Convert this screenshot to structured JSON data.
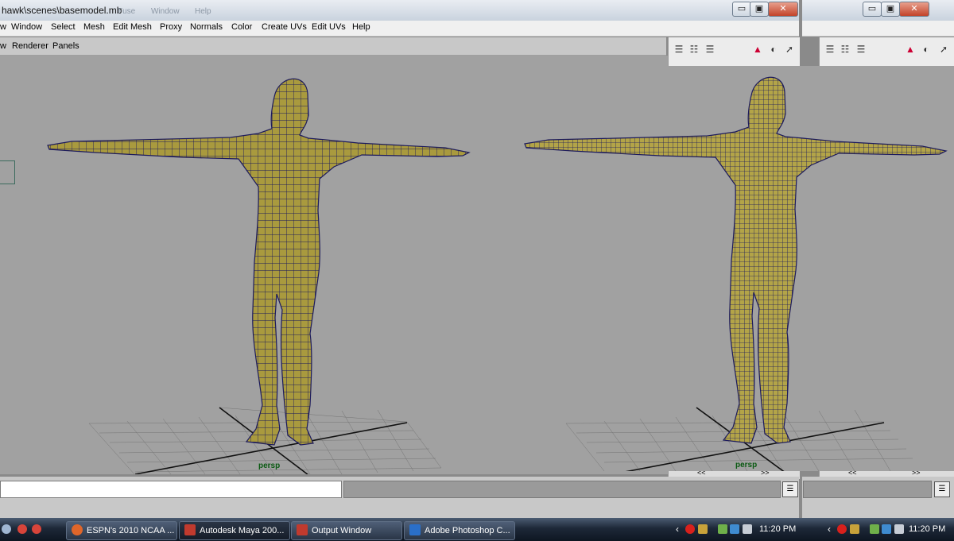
{
  "window": {
    "title": "hawk\\scenes\\basemodel.mb",
    "faded_menu": [
      "Fuse",
      "Window",
      "Help"
    ],
    "minimize": "▭",
    "maximize": "▣",
    "close": "✕"
  },
  "menubar": [
    "w",
    "Window",
    "Select",
    "Mesh",
    "Edit Mesh",
    "Proxy",
    "Normals",
    "Color",
    "Create UVs",
    "Edit UVs",
    "Help"
  ],
  "panel_menu": [
    "w",
    "Renderer",
    "Panels"
  ],
  "viewports": [
    {
      "camera": "persp"
    },
    {
      "camera": "persp"
    }
  ],
  "channel_box": {
    "scroll_left": "<<",
    "scroll_right": ">>"
  },
  "taskbar": {
    "tasks": [
      {
        "label": "ESPN's 2010 NCAA ...",
        "icon": "firefox-icon",
        "color": "#e0662a"
      },
      {
        "label": "Autodesk Maya 200...",
        "icon": "maya-icon",
        "color": "#c03a2e"
      },
      {
        "label": "Output Window",
        "icon": "maya-icon",
        "color": "#c03a2e"
      },
      {
        "label": "Adobe Photoshop C...",
        "icon": "photoshop-icon",
        "color": "#2a6fc9"
      }
    ],
    "clock": "11:20 PM",
    "clock2": "11:20 PM"
  },
  "colors": {
    "mesh_fill": "#a99a3e",
    "mesh_wire": "#1c1a5c",
    "viewport_bg": "#a1a1a1",
    "grid": "#6a6a6a",
    "camera_label": "#0a5a12"
  }
}
